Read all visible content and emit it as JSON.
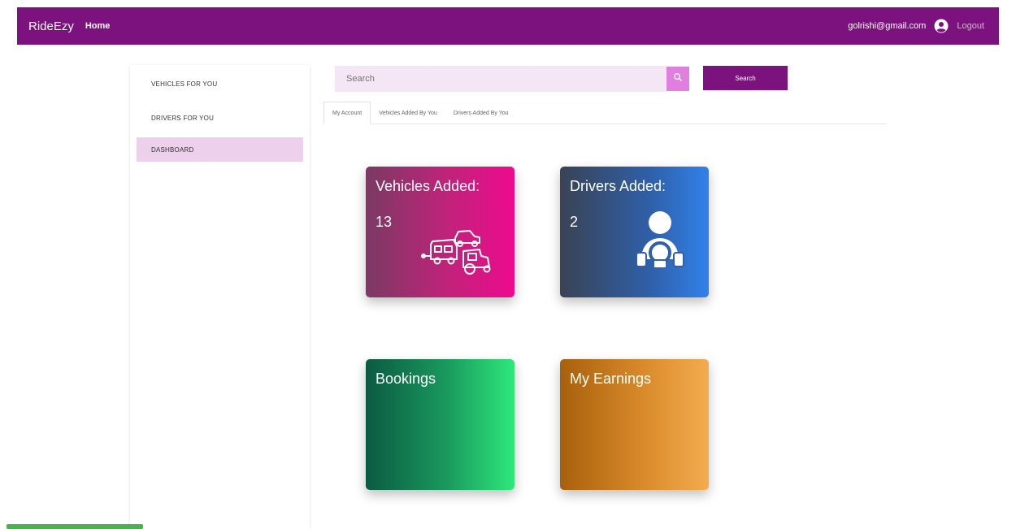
{
  "navbar": {
    "brand": "RideEzy",
    "home_label": "Home",
    "email": "golrishi@gmail.com",
    "logout_label": "Logout",
    "bg_color": "#7b127d"
  },
  "sidebar": {
    "items": [
      {
        "label": "VEHICLES FOR YOU",
        "active": false
      },
      {
        "label": "DRIVERS FOR YOU",
        "active": false
      },
      {
        "label": "DASHBOARD",
        "active": true
      }
    ]
  },
  "search": {
    "placeholder": "Search",
    "button_label": "Search"
  },
  "tabs": [
    {
      "label": "My Account",
      "active": true
    },
    {
      "label": "Vehicles Added By You",
      "active": false
    },
    {
      "label": "Drivers Added By You",
      "active": false
    }
  ],
  "cards": {
    "vehicles": {
      "title": "Vehicles Added:",
      "value": "13",
      "icon": "vehicles-icon"
    },
    "drivers": {
      "title": "Drivers Added:",
      "value": "2",
      "icon": "driver-icon"
    },
    "bookings": {
      "title": "Bookings"
    },
    "earnings": {
      "title": "My Earnings"
    }
  },
  "colors": {
    "accent": "#7b127d",
    "active_sidebar": "#ecd0ec",
    "search_bg": "#f4e6f4"
  }
}
